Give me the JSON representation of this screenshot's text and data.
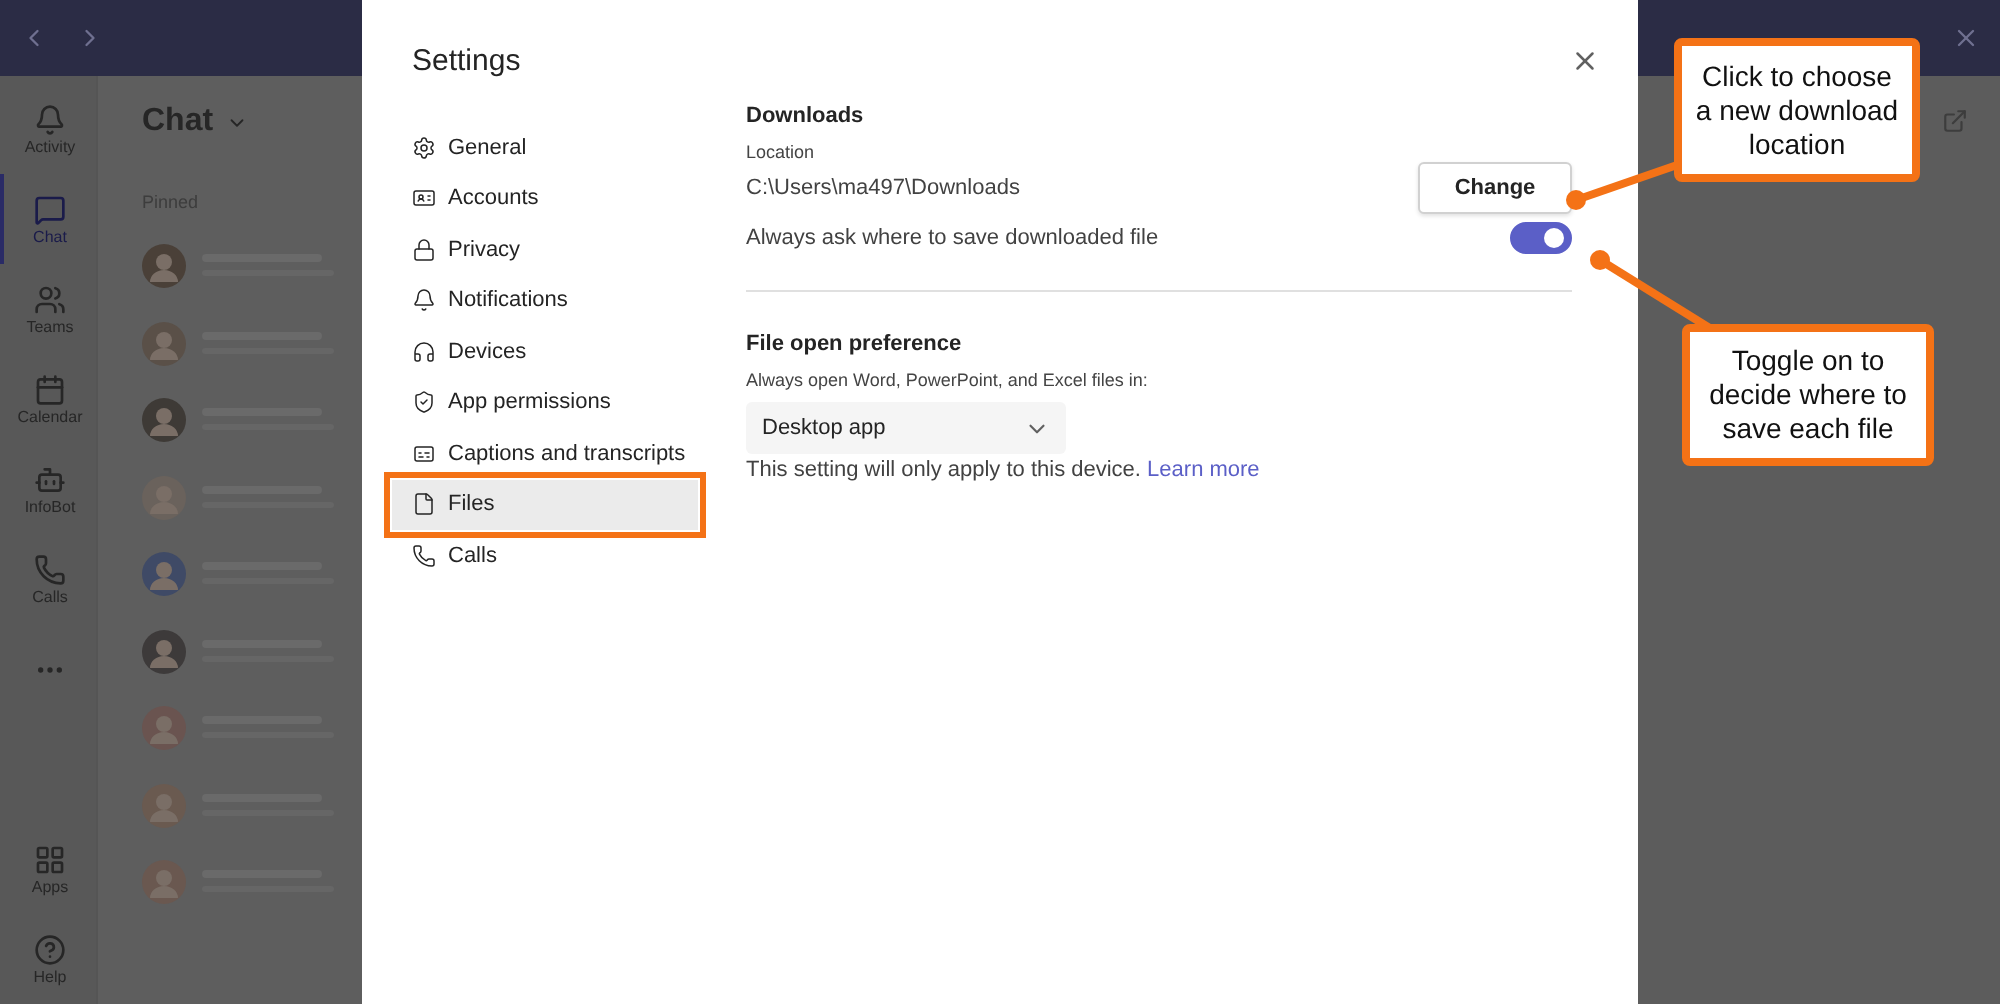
{
  "rail": [
    {
      "label": "Activity",
      "selected": false
    },
    {
      "label": "Chat",
      "selected": true
    },
    {
      "label": "Teams",
      "selected": false
    },
    {
      "label": "Calendar",
      "selected": false
    },
    {
      "label": "InfoBot",
      "selected": false
    },
    {
      "label": "Calls",
      "selected": false
    },
    {
      "label": "Apps",
      "selected": false
    },
    {
      "label": "Help",
      "selected": false
    }
  ],
  "chat_list": {
    "title": "Chat",
    "section": "Pinned"
  },
  "settings": {
    "title": "Settings",
    "nav": [
      {
        "label": "General",
        "selected": false,
        "highlighted": false
      },
      {
        "label": "Accounts",
        "selected": false,
        "highlighted": false
      },
      {
        "label": "Privacy",
        "selected": false,
        "highlighted": false
      },
      {
        "label": "Notifications",
        "selected": false,
        "highlighted": false
      },
      {
        "label": "Devices",
        "selected": false,
        "highlighted": false
      },
      {
        "label": "App permissions",
        "selected": false,
        "highlighted": false
      },
      {
        "label": "Captions and transcripts",
        "selected": false,
        "highlighted": false
      },
      {
        "label": "Files",
        "selected": true,
        "highlighted": true
      },
      {
        "label": "Calls",
        "selected": false,
        "highlighted": false
      }
    ],
    "downloads": {
      "heading": "Downloads",
      "location_label": "Location",
      "path": "C:\\Users\\ma497\\Downloads",
      "button": "Change",
      "toggle_label": "Always ask where to save downloaded file",
      "toggle_on": true
    },
    "file_open": {
      "heading": "File open preference",
      "label": "Always open Word, PowerPoint, and Excel files in:",
      "dropdown": "Desktop app",
      "note": "This setting will only apply to this device.",
      "link": "Learn more"
    }
  },
  "callouts": [
    {
      "text": "Click to choose a new download location"
    },
    {
      "text": "Toggle on to decide where to save each file"
    }
  ]
}
